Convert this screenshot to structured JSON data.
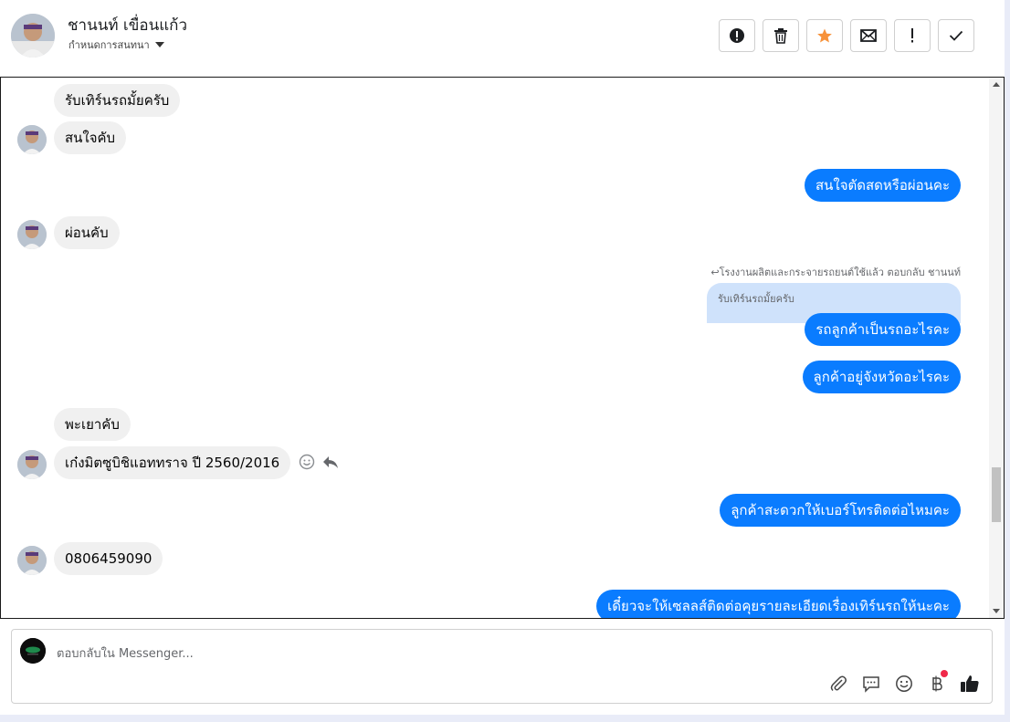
{
  "header": {
    "contact_name": "ชานนท์ เขื่อนแก้ว",
    "label_select": "กำหนดการสนทนา"
  },
  "toolbar": {
    "buttons": [
      {
        "name": "report-spam-button",
        "icon": "alert-circle-icon"
      },
      {
        "name": "delete-button",
        "icon": "trash-icon"
      },
      {
        "name": "star-button",
        "icon": "star-icon"
      },
      {
        "name": "mark-unread-button",
        "icon": "envelope-icon"
      },
      {
        "name": "follow-up-button",
        "icon": "exclamation-icon"
      },
      {
        "name": "mark-done-button",
        "icon": "check-icon"
      }
    ],
    "star_color": "#f7923a"
  },
  "messages": {
    "m1": "รับเทิร์นรถมั้ยครับ",
    "m2": "สนใจคับ",
    "m3": "สนใจตัดสดหรือผ่อนคะ",
    "m4": "ผ่อนคับ",
    "reply_note": "โรงงานผลิตและกระจายรถยนต์ใช้แล้ว ตอบกลับ ชานนท์",
    "quoted": "รับเทิร์นรถมั้ยครับ",
    "m5": "รถลูกค้าเป็นรถอะไรคะ",
    "m6": "ลูกค้าอยู่จังหวัดอะไรคะ",
    "m7": "พะเยาคับ",
    "m8": "เก๋งมิตซูบิชิแอททราจ ปี 2560/2016",
    "m9": "ลูกค้าสะดวกให้เบอร์โทรติดต่อไหมคะ",
    "m10": "0806459090",
    "m11": "เดี๋ยวจะให้เซลลส์ติดต่อคุยรายละเอียดเรื่องเทิร์นรถให้นะคะ"
  },
  "composer": {
    "placeholder": "ตอบกลับใน Messenger...",
    "tools": [
      "paperclip-icon",
      "saved-replies-icon",
      "emoji-icon",
      "baht-payment-icon",
      "thumbs-up-icon"
    ]
  },
  "colors": {
    "outgoing_bubble": "#0a7cff",
    "incoming_bubble": "#f0f0f0",
    "quoted_bubble": "#cfe2fb"
  }
}
